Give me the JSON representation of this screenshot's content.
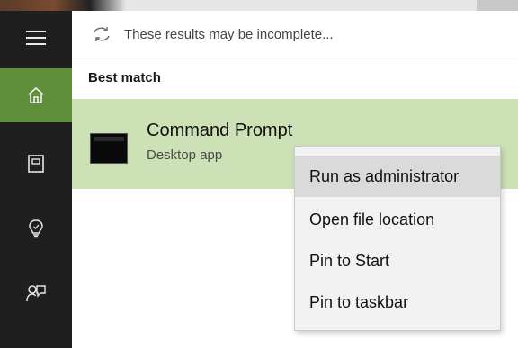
{
  "notice": {
    "text": "These results may be incomplete...",
    "icon": "refresh-icon"
  },
  "section": {
    "title": "Best match"
  },
  "result": {
    "name": "Command Prompt",
    "type": "Desktop app",
    "icon": "command-prompt-icon"
  },
  "context_menu": {
    "items": [
      {
        "label": "Run as administrator",
        "highlighted": true
      },
      {
        "label": "Open file location",
        "highlighted": false
      },
      {
        "label": "Pin to Start",
        "highlighted": false
      },
      {
        "label": "Pin to taskbar",
        "highlighted": false
      }
    ]
  },
  "rail": {
    "items": [
      {
        "icon": "hamburger-menu-icon",
        "active": false
      },
      {
        "icon": "home-icon",
        "active": true
      },
      {
        "icon": "notebook-icon",
        "active": false
      },
      {
        "icon": "lightbulb-icon",
        "active": false
      },
      {
        "icon": "feedback-icon",
        "active": false
      }
    ]
  },
  "colors": {
    "rail_bg": "#1f1f1f",
    "accent": "#5f8f3a",
    "result_highlight": "#cde1b6",
    "menu_bg": "#f2f2f2",
    "menu_hover": "#dadada"
  }
}
